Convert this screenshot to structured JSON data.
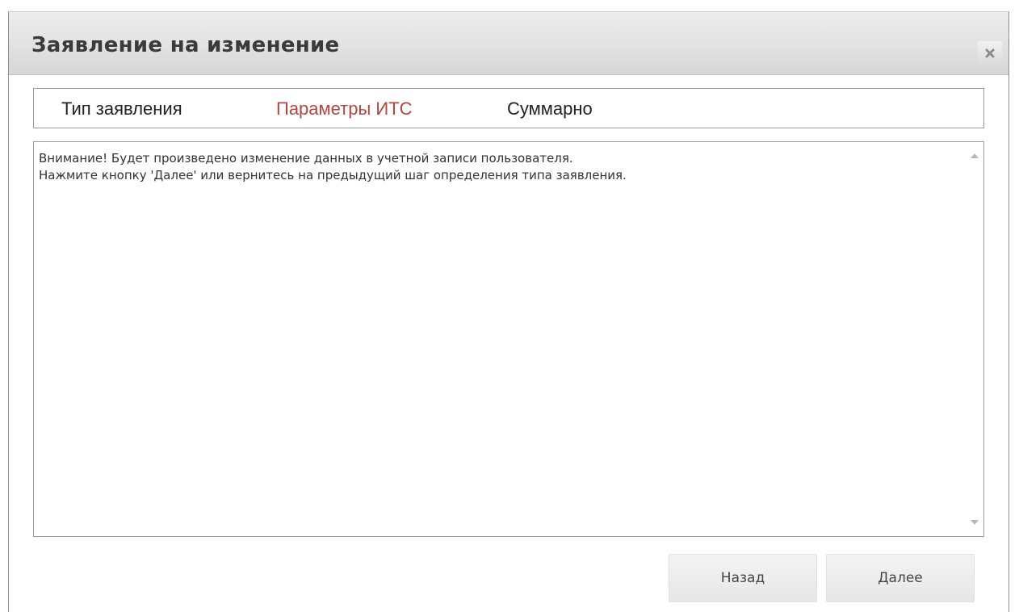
{
  "dialog": {
    "title": "Заявление на изменение",
    "close_icon": "close-icon"
  },
  "tabs": [
    {
      "label": "Тип заявления",
      "active": false
    },
    {
      "label": "Параметры ИТС",
      "active": true
    },
    {
      "label": "Суммарно",
      "active": false
    }
  ],
  "message": {
    "line1": "Внимание! Будет произведено изменение данных в учетной записи пользователя.",
    "line2": "Нажмите кнопку 'Далее' или вернитесь на предыдущий шаг определения типа заявления."
  },
  "buttons": {
    "back_label": "Назад",
    "next_label": "Далее"
  },
  "colors": {
    "active_tab": "#b5443f",
    "text": "#222222",
    "border": "#9a9a9a"
  }
}
